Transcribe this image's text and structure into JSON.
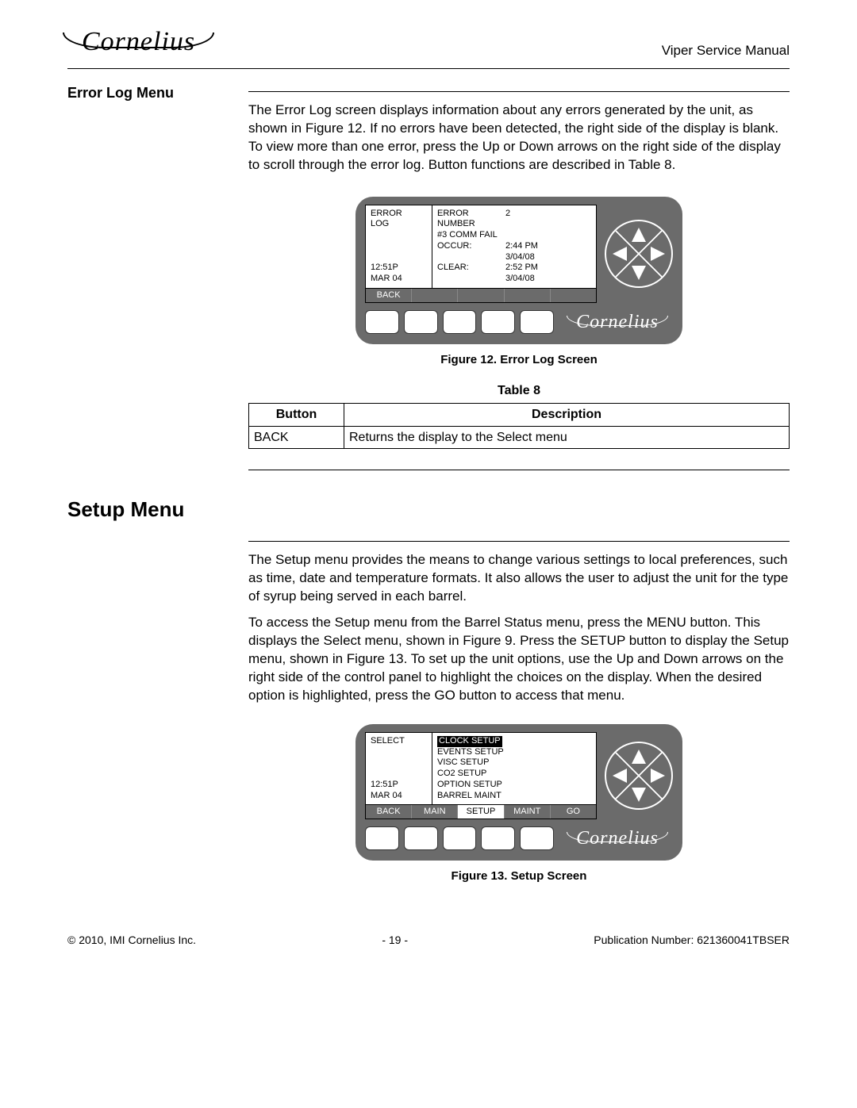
{
  "header": {
    "brand": "Cornelius",
    "doc_title": "Viper Service Manual"
  },
  "section1": {
    "heading": "Error Log Menu",
    "paragraph": "The Error Log screen displays information about any errors generated by the unit, as shown in Figure 12. If no errors have been detected, the right side of the display is blank. To view more than one error, press the Up or Down arrows on the right side of the display to scroll through the error log. Button functions are described in Table 8."
  },
  "fig12": {
    "caption": "Figure 12. Error Log Screen",
    "lcd_left_top": "ERROR\nLOG",
    "lcd_left_time": "12:51P",
    "lcd_left_date": "MAR 04",
    "rows": [
      [
        "ERROR NUMBER",
        "2"
      ],
      [
        "#3 COMM FAIL",
        ""
      ],
      [
        "OCCUR:",
        "2:44 PM"
      ],
      [
        "",
        "3/04/08"
      ],
      [
        "CLEAR:",
        "2:52 PM"
      ],
      [
        "",
        "3/04/08"
      ]
    ],
    "softkeys": [
      "BACK",
      "",
      "",
      "",
      ""
    ]
  },
  "table8": {
    "caption": "Table 8",
    "headers": [
      "Button",
      "Description"
    ],
    "rows": [
      [
        "BACK",
        "Returns the display to the Select menu"
      ]
    ]
  },
  "section2": {
    "heading": "Setup Menu",
    "p1": "The Setup menu provides the means to change various settings to local preferences, such as time, date and temperature formats. It also allows the user to adjust the unit for the type of syrup being served in each barrel.",
    "p2": "To access the Setup menu from the Barrel Status menu, press the MENU button. This displays the Select menu, shown in Figure 9. Press the SETUP button to display the Setup menu, shown in Figure 13. To set up the unit options, use the Up and Down arrows on the right side of the control panel to highlight the choices on the display. When the desired option is highlighted, press the GO button to access that menu."
  },
  "fig13": {
    "caption": "Figure 13. Setup Screen",
    "lcd_left_top": "SELECT",
    "lcd_left_time": "12:51P",
    "lcd_left_date": "MAR 04",
    "menu": [
      "CLOCK SETUP",
      "EVENTS SETUP",
      "VISC SETUP",
      "CO2 SETUP",
      "OPTION SETUP",
      "BARREL MAINT"
    ],
    "selected_index": 0,
    "softkeys": [
      "BACK",
      "MAIN",
      "SETUP",
      "MAINT",
      "GO"
    ],
    "softkeys_inv": [
      false,
      false,
      true,
      false,
      false
    ]
  },
  "footer": {
    "left": "© 2010, IMI Cornelius Inc.",
    "center": "- 19 -",
    "right": "Publication Number: 621360041TBSER"
  }
}
